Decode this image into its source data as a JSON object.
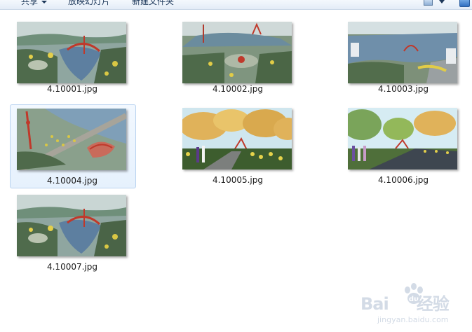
{
  "toolbar": {
    "share_label": "共享",
    "slideshow_label": "放映幻灯片",
    "new_folder_label": "新建文件夹"
  },
  "files": [
    {
      "name": "4.10001.jpg",
      "kind": "aerial-lake"
    },
    {
      "name": "4.10002.jpg",
      "kind": "aerial-plaza"
    },
    {
      "name": "4.10003.jpg",
      "kind": "aerial-shore"
    },
    {
      "name": "4.10004.jpg",
      "kind": "aerial-tower",
      "selected": true
    },
    {
      "name": "4.10005.jpg",
      "kind": "path-trees"
    },
    {
      "name": "4.10006.jpg",
      "kind": "road-trees"
    },
    {
      "name": "4.10007.jpg",
      "kind": "aerial-lake"
    }
  ],
  "watermark": {
    "brand": "Bai",
    "brand_tail": "经验",
    "url": "jingyan.baidu.com"
  },
  "colors": {
    "selection_bg": "#e6f1fd",
    "selection_border": "#b9d3f0",
    "toolbar_text": "#1e395b"
  }
}
